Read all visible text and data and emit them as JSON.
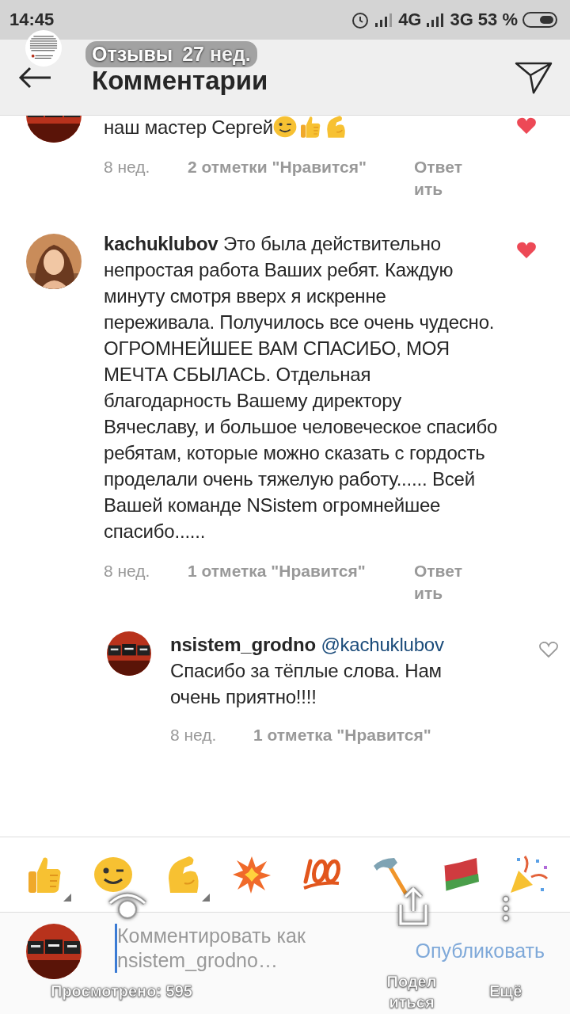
{
  "status_bar": {
    "time": "14:45",
    "network_1": "4G",
    "network_2": "3G",
    "battery": "53 %"
  },
  "story_overlay": {
    "title": "Отзывы",
    "age": "27 нед.",
    "views": "Просмотрено: 595",
    "share": "Поделиться",
    "more": "Ещё"
  },
  "header": {
    "title": "Комментарии"
  },
  "comments": [
    {
      "text": "наш мастер Сергей",
      "emojis": [
        {
          "kind": "wink"
        },
        {
          "kind": "thumbs_up"
        },
        {
          "kind": "muscle"
        }
      ],
      "time": "8 нед.",
      "likes": "2 отметки \"Нравится\"",
      "reply": "Ответить",
      "liked": true,
      "avatar": {
        "kind": "logo"
      }
    },
    {
      "author": "kachuklubov",
      "text": "Это была действительно непростая работа Ваших ребят. Каждую минуту смотря вверх я искренне переживала. Получилось все очень чудесно. ОГРОМНЕЙШЕЕ ВАМ СПАСИБО, МОЯ МЕЧТА СБЫЛАСЬ. Отдельная благодарность Вашему директору Вячеславу, и большое человеческое спасибо ребятам, которые можно сказать с гордость проделали очень тяжелую работу...... Всей Вашей команде NSistem огромнейшее спасибо......",
      "time": "8 нед.",
      "likes": "1 отметка \"Нравится\"",
      "reply": "Ответить",
      "liked": true,
      "avatar": {
        "kind": "person"
      },
      "children": [
        {
          "author": "nsistem_grodno",
          "mention": "@kachuklubov",
          "text": "Спасибо за тёплые слова. Нам очень приятно!!!!",
          "time": "8 нед.",
          "likes": "1 отметка \"Нравится\"",
          "liked": false,
          "avatar": {
            "kind": "logo"
          }
        }
      ]
    }
  ],
  "emoji_bar": [
    {
      "kind": "thumbs_up",
      "has_variants": true
    },
    {
      "kind": "wink",
      "has_variants": false
    },
    {
      "kind": "muscle",
      "has_variants": true
    },
    {
      "kind": "collision",
      "has_variants": false
    },
    {
      "kind": "hundred",
      "has_variants": false
    },
    {
      "kind": "hammer",
      "has_variants": false
    },
    {
      "kind": "flag",
      "has_variants": false
    },
    {
      "kind": "party",
      "has_variants": false
    }
  ],
  "composer": {
    "placeholder": "Комментировать как nsistem_grodno…",
    "post": "Опубликовать"
  }
}
